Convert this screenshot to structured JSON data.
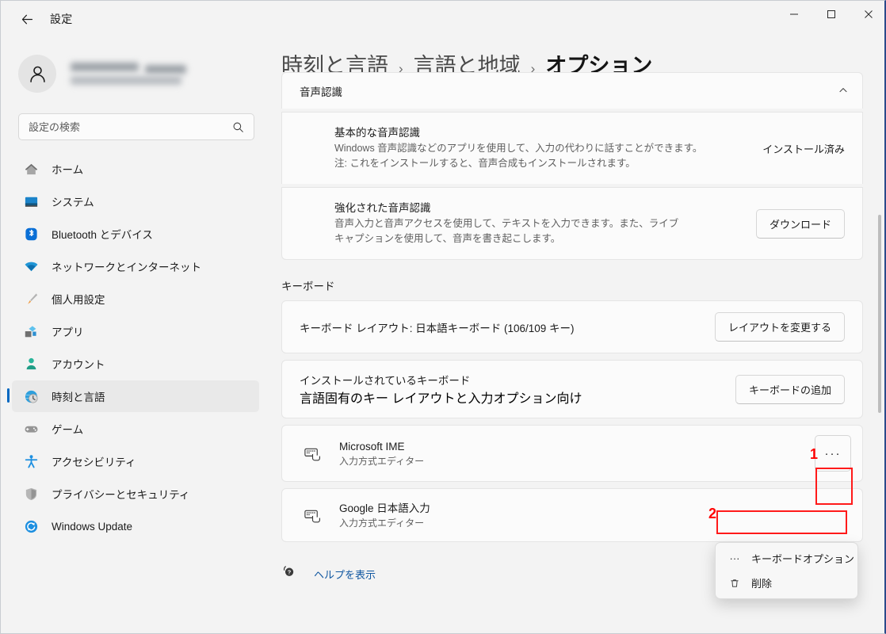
{
  "window": {
    "title": "設定",
    "back_icon": "back-arrow-icon",
    "minimize": "−",
    "maximize": "□",
    "close": "✕"
  },
  "sidebar": {
    "account": {
      "avatar_icon": "person-avatar-icon",
      "name_redacted": true
    },
    "search": {
      "placeholder": "設定の検索",
      "value": "",
      "icon": "search-icon"
    },
    "items": [
      {
        "label": "ホーム",
        "icon": "home-icon",
        "active": false
      },
      {
        "label": "システム",
        "icon": "system-monitor-icon",
        "active": false
      },
      {
        "label": "Bluetooth とデバイス",
        "icon": "bluetooth-icon",
        "active": false
      },
      {
        "label": "ネットワークとインターネット",
        "icon": "wifi-icon",
        "active": false
      },
      {
        "label": "個人用設定",
        "icon": "paintbrush-icon",
        "active": false
      },
      {
        "label": "アプリ",
        "icon": "apps-icon",
        "active": false
      },
      {
        "label": "アカウント",
        "icon": "account-person-icon",
        "active": false
      },
      {
        "label": "時刻と言語",
        "icon": "clock-globe-icon",
        "active": true
      },
      {
        "label": "ゲーム",
        "icon": "gamepad-icon",
        "active": false
      },
      {
        "label": "アクセシビリティ",
        "icon": "accessibility-icon",
        "active": false
      },
      {
        "label": "プライバシーとセキュリティ",
        "icon": "shield-icon",
        "active": false
      },
      {
        "label": "Windows Update",
        "icon": "update-refresh-icon",
        "active": false
      }
    ]
  },
  "breadcrumb": {
    "items": [
      "時刻と言語",
      "言語と地域",
      "オプション"
    ],
    "separator": "›"
  },
  "speech": {
    "collapsed_header": "音声認識",
    "collapse_icon": "chevron-up-icon",
    "basic": {
      "title": "基本的な音声認識",
      "desc_line1": "Windows 音声認識などのアプリを使用して、入力の代わりに話すことができます。",
      "desc_line2": "注: これをインストールすると、音声合成もインストールされます。",
      "status": "インストール済み"
    },
    "enhanced": {
      "title": "強化された音声認識",
      "desc_line1": "音声入力と音声アクセスを使用して、テキストを入力できます。また、ライブ",
      "desc_line2": "キャプションを使用して、音声を書き起こします。",
      "button": "ダウンロード"
    }
  },
  "keyboard": {
    "section_title": "キーボード",
    "layout_row": {
      "label": "キーボード レイアウト: 日本語キーボード (106/109 キー)",
      "button": "レイアウトを変更する"
    },
    "installed_row": {
      "title": "インストールされているキーボード",
      "subtitle": "言語固有のキー レイアウトと入力オプション向け",
      "button": "キーボードの追加"
    },
    "imes": [
      {
        "name": "Microsoft IME",
        "subtitle": "入力方式エディター",
        "icon": "keyboard-hand-icon",
        "more_button": "···"
      },
      {
        "name": "Google 日本語入力",
        "subtitle": "入力方式エディター",
        "icon": "keyboard-hand-icon",
        "more_button": ""
      }
    ]
  },
  "context_menu": {
    "items": [
      {
        "label": "キーボードオプション",
        "icon": "ellipsis-icon",
        "highlighted": true
      },
      {
        "label": "削除",
        "icon": "trash-icon",
        "highlighted": false
      }
    ]
  },
  "footer": {
    "help_icon": "help-question-icon",
    "help_label": "ヘルプを表示"
  },
  "annotations": {
    "markers": [
      {
        "number": "1",
        "target": "ime-more-button"
      },
      {
        "number": "2",
        "target": "context-menu-keyboard-options"
      }
    ],
    "color": "#ff0000"
  }
}
